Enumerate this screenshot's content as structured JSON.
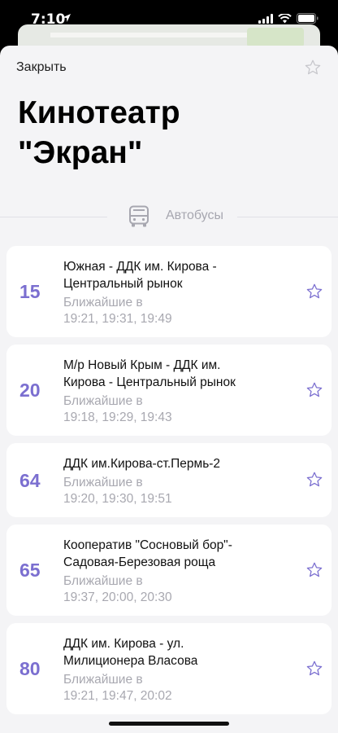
{
  "status_bar": {
    "time": "7:10"
  },
  "header": {
    "close_label": "Закрыть",
    "title_line1": "Кинотеатр",
    "title_line2": "\"Экран\""
  },
  "section": {
    "label": "Автобусы",
    "icon": "bus-icon"
  },
  "routes": [
    {
      "number": "15",
      "name_line1": "Южная - ДДК им. Кирова -",
      "name_line2": "Центральный рынок",
      "next_label": "Ближайшие в",
      "next_times": "19:21, 19:31, 19:49"
    },
    {
      "number": "20",
      "name_line1": "М/р Новый Крым - ДДК им.",
      "name_line2": "Кирова - Центральный рынок",
      "next_label": "Ближайшие в",
      "next_times": "19:18, 19:29, 19:43"
    },
    {
      "number": "64",
      "name_line1": "ДДК им.Кирова-ст.Пермь-2",
      "name_line2": "",
      "next_label": "Ближайшие в",
      "next_times": "19:20, 19:30, 19:51"
    },
    {
      "number": "65",
      "name_line1": "Кооператив \"Сосновый бор\"-",
      "name_line2": "Садовая-Березовая роща",
      "next_label": "Ближайшие в",
      "next_times": "19:37, 20:00, 20:30"
    },
    {
      "number": "80",
      "name_line1": "ДДК им. Кирова - ул.",
      "name_line2": "Милиционера Власова",
      "next_label": "Ближайшие в",
      "next_times": "19:21, 19:47, 20:02"
    }
  ],
  "colors": {
    "accent": "#7b6fd0",
    "muted": "#a8a8b0",
    "sheet_bg": "#f4f4f6"
  }
}
